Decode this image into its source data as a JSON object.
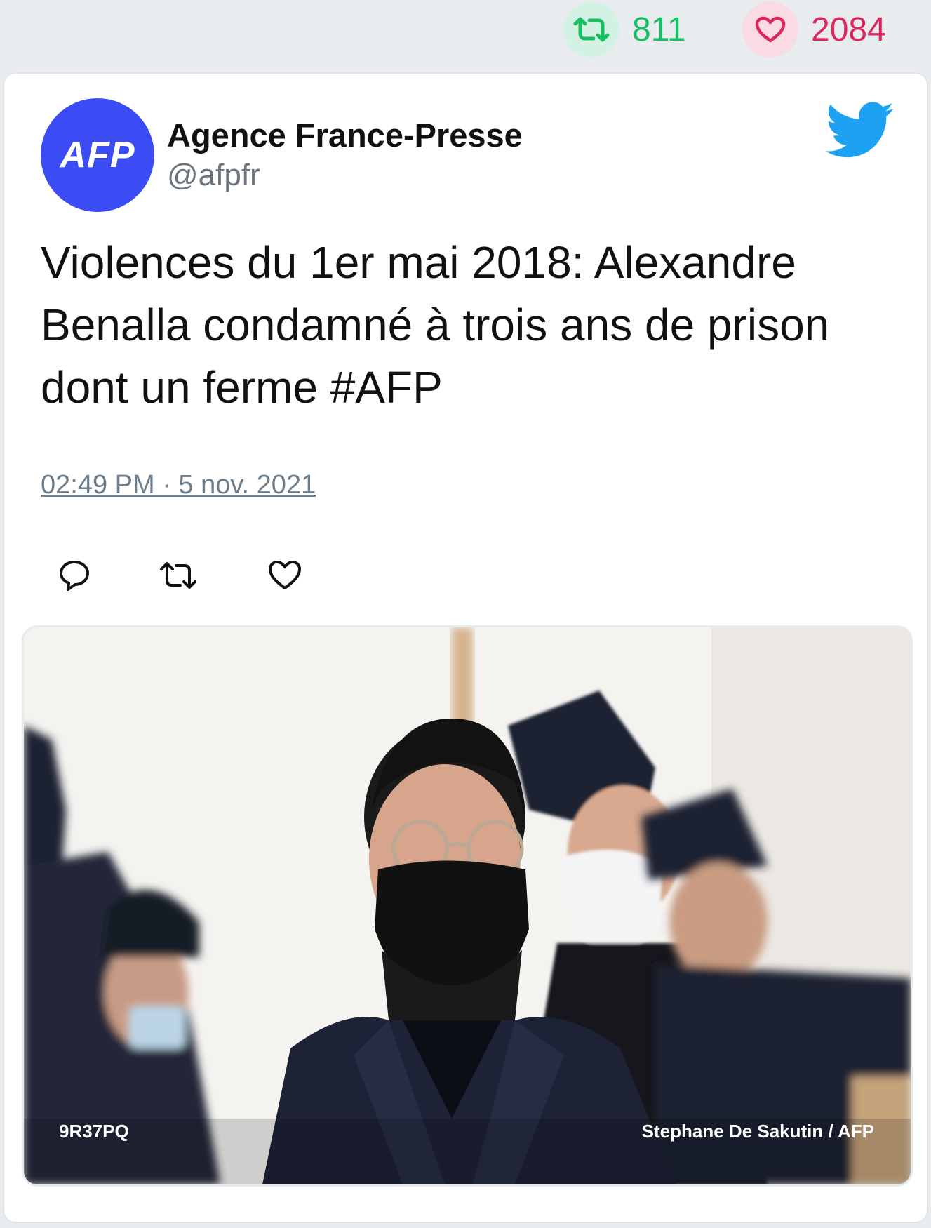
{
  "stats": {
    "retweets": "811",
    "likes": "2084",
    "retweet_color": "#17bf63",
    "like_color": "#e0245e"
  },
  "tweet": {
    "avatar_text": "AFP",
    "author_name": "Agence France-Presse",
    "author_handle": "@afpfr",
    "text": "Violences du 1er mai 2018: Alexandre Benalla condamné à trois ans de prison dont un ferme #AFP",
    "timestamp": "02:49 PM · 5 nov. 2021",
    "brand_icon": "twitter-bird-icon",
    "actions": [
      "reply-icon",
      "retweet-icon",
      "like-icon"
    ]
  },
  "media": {
    "code": "9R37PQ",
    "credit": "Stephane De Sakutin / AFP"
  },
  "colors": {
    "avatar_bg": "#3b4cf5",
    "twitter_blue": "#1da1f2"
  }
}
